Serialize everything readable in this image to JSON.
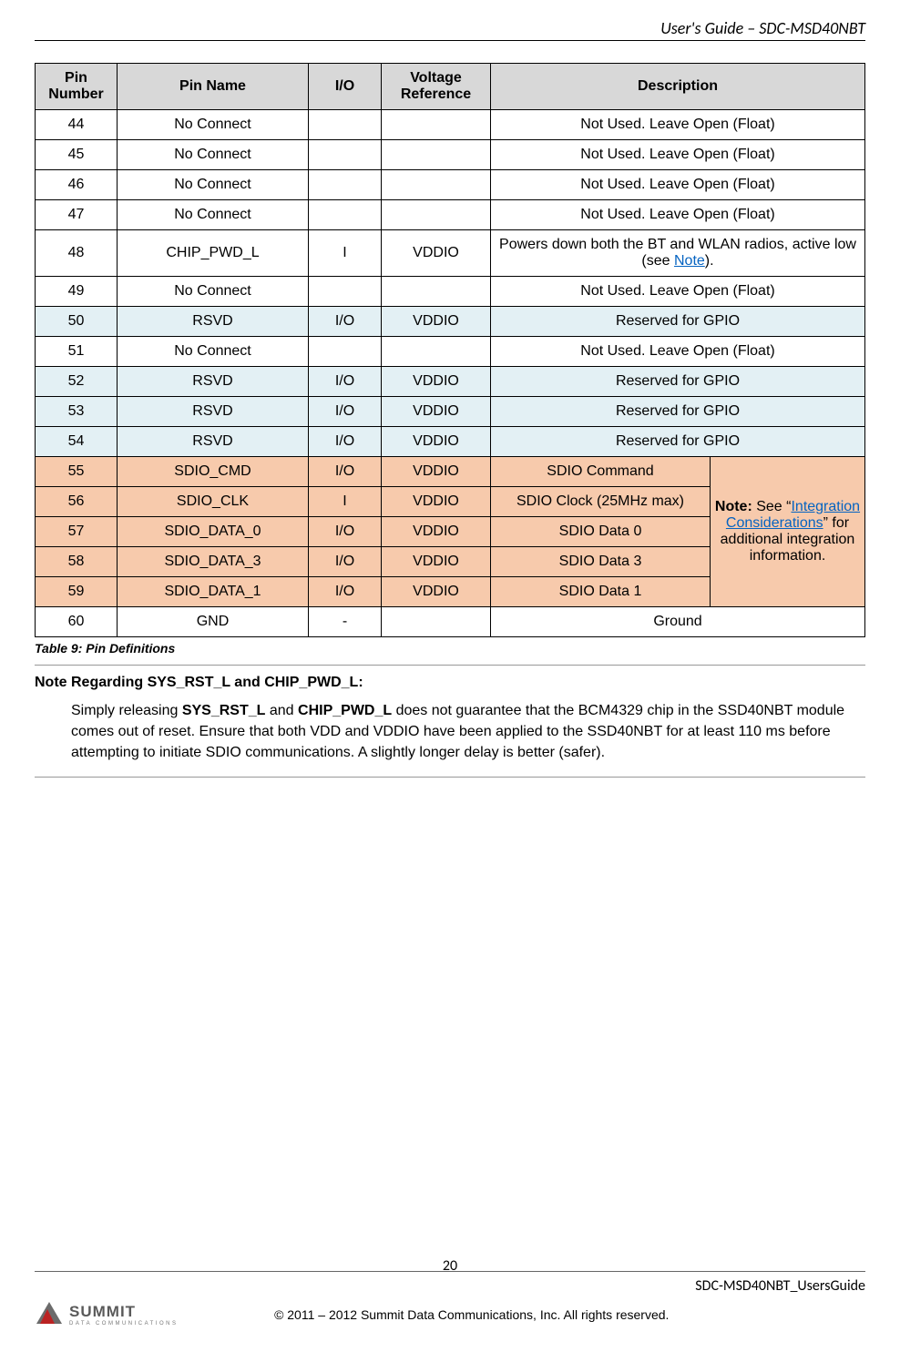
{
  "header": {
    "title": "User's Guide – SDC-MSD40NBT"
  },
  "table": {
    "headers": {
      "pin_number": "Pin Number",
      "pin_name": "Pin Name",
      "io": "I/O",
      "vref": "Voltage Reference",
      "desc": "Description"
    },
    "rows": [
      {
        "num": "44",
        "name": "No Connect",
        "io": "",
        "vref": "",
        "desc": "Not Used. Leave Open (Float)",
        "cls": ""
      },
      {
        "num": "45",
        "name": "No Connect",
        "io": "",
        "vref": "",
        "desc": "Not Used. Leave Open (Float)",
        "cls": ""
      },
      {
        "num": "46",
        "name": "No Connect",
        "io": "",
        "vref": "",
        "desc": "Not Used. Leave Open (Float)",
        "cls": ""
      },
      {
        "num": "47",
        "name": "No Connect",
        "io": "",
        "vref": "",
        "desc": "Not Used. Leave Open (Float)",
        "cls": ""
      },
      {
        "num": "48",
        "name": "CHIP_PWD_L",
        "io": "I",
        "vref": "VDDIO",
        "desc_pre": "Powers down both the BT and WLAN radios, active low (see ",
        "desc_link": "Note",
        "desc_post": ").",
        "cls": "",
        "has_link": true
      },
      {
        "num": "49",
        "name": "No Connect",
        "io": "",
        "vref": "",
        "desc": "Not Used. Leave Open (Float)",
        "cls": ""
      },
      {
        "num": "50",
        "name": "RSVD",
        "io": "I/O",
        "vref": "VDDIO",
        "desc": "Reserved for GPIO",
        "cls": "row-blue"
      },
      {
        "num": "51",
        "name": "No Connect",
        "io": "",
        "vref": "",
        "desc": "Not Used. Leave Open (Float)",
        "cls": ""
      },
      {
        "num": "52",
        "name": "RSVD",
        "io": "I/O",
        "vref": "VDDIO",
        "desc": "Reserved for GPIO",
        "cls": "row-blue"
      },
      {
        "num": "53",
        "name": "RSVD",
        "io": "I/O",
        "vref": "VDDIO",
        "desc": "Reserved for GPIO",
        "cls": "row-blue"
      },
      {
        "num": "54",
        "name": "RSVD",
        "io": "I/O",
        "vref": "VDDIO",
        "desc": "Reserved for GPIO",
        "cls": "row-blue"
      }
    ],
    "sdio_rows": [
      {
        "num": "55",
        "name": "SDIO_CMD",
        "io": "I/O",
        "vref": "VDDIO",
        "desc": "SDIO Command"
      },
      {
        "num": "56",
        "name": "SDIO_CLK",
        "io": "I",
        "vref": "VDDIO",
        "desc": "SDIO Clock (25MHz max)"
      },
      {
        "num": "57",
        "name": "SDIO_DATA_0",
        "io": "I/O",
        "vref": "VDDIO",
        "desc": "SDIO Data 0"
      },
      {
        "num": "58",
        "name": "SDIO_DATA_3",
        "io": "I/O",
        "vref": "VDDIO",
        "desc": "SDIO Data 3"
      },
      {
        "num": "59",
        "name": "SDIO_DATA_1",
        "io": "I/O",
        "vref": "VDDIO",
        "desc": "SDIO Data 1"
      }
    ],
    "sdio_note": {
      "bold": "Note:",
      "pre": " See “",
      "link": "Integration Considerations",
      "post": "” for additional integration information."
    },
    "last_row": {
      "num": "60",
      "name": "GND",
      "io": "-",
      "vref": "",
      "desc": "Ground"
    },
    "caption": "Table 9: Pin Definitions"
  },
  "note_section": {
    "heading": "Note Regarding SYS_RST_L and CHIP_PWD_L:",
    "body_pre": "Simply releasing ",
    "body_b1": "SYS_RST_L",
    "body_mid1": " and ",
    "body_b2": "CHIP_PWD_L",
    "body_post": " does not guarantee that the BCM4329 chip in the SSD40NBT module comes out of reset.  Ensure that both VDD and VDDIO have been applied to the SSD40NBT for at least 110 ms before attempting to initiate SDIO communications.  A slightly longer delay is better (safer)."
  },
  "footer": {
    "page_number": "20",
    "doc_id": "SDC-MSD40NBT_UsersGuide",
    "logo_brand": "SUMMIT",
    "logo_sub": "DATA  COMMUNICATIONS",
    "copyright": "© 2011 – 2012 Summit Data Communications, Inc. All rights reserved."
  }
}
